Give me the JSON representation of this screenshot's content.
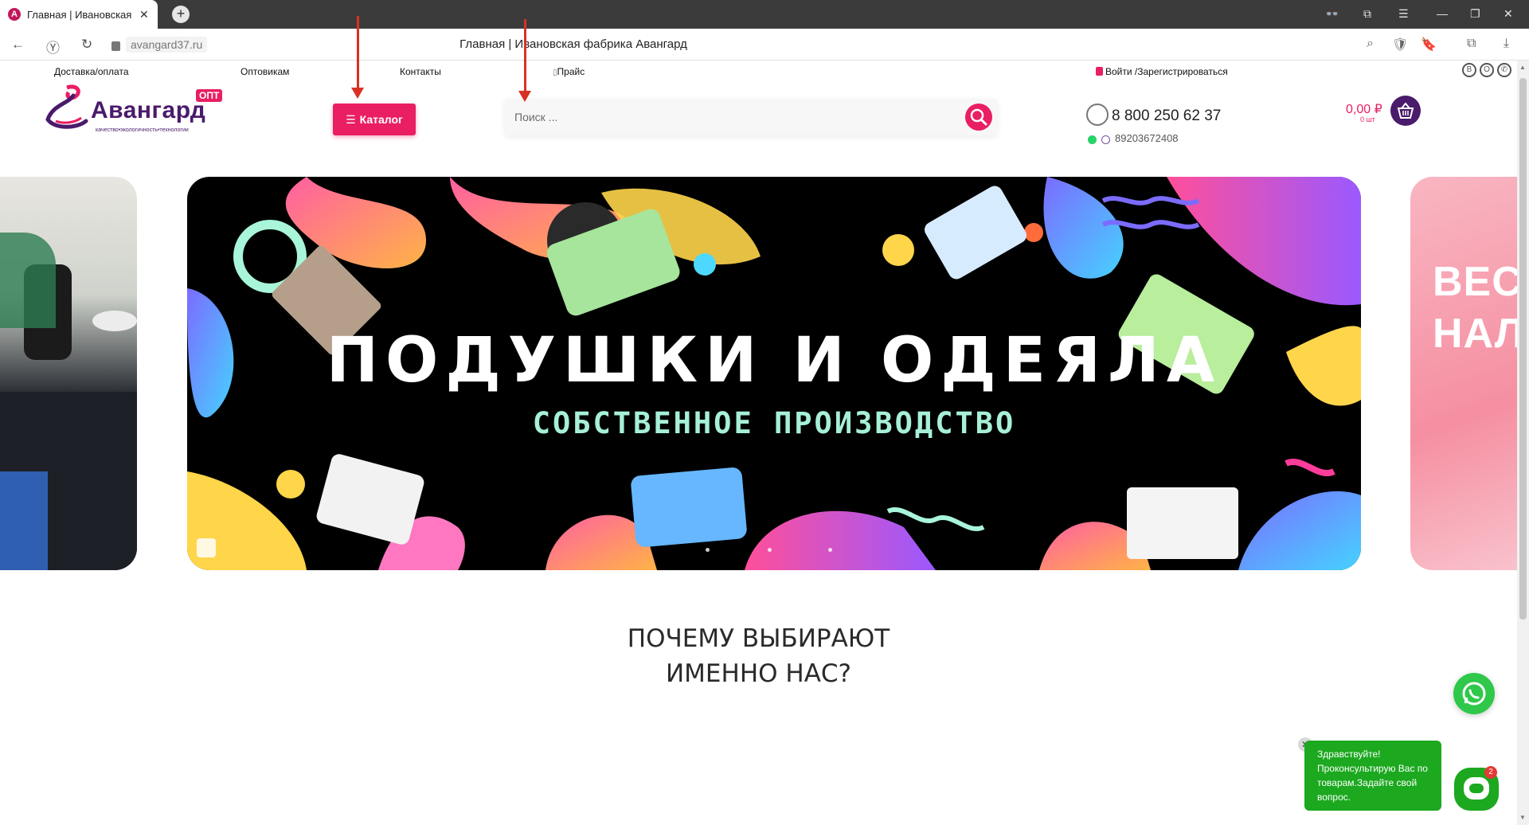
{
  "browser": {
    "tab_title": "Главная | Ивановская ф",
    "favicon_letter": "A",
    "url": "avangard37.ru",
    "page_title": "Главная | Ивановская фабрика Авангард"
  },
  "topnav": {
    "delivery": "Доставка/оплата",
    "wholesale": "Оптовикам",
    "contacts": "Контакты",
    "price": "Прайс",
    "login": "Войти /Зарегистрироваться"
  },
  "logo": {
    "name": "Авангард",
    "badge": "ОПТ",
    "tagline": "качество•экологичность•технологии"
  },
  "catalog_label": "Каталог",
  "search": {
    "placeholder": "Поиск ..."
  },
  "contacts": {
    "phone_main": "8 800 250 62 37",
    "phone_messenger": "89203672408"
  },
  "cart": {
    "total": "0,00 ₽",
    "count": "0 шт"
  },
  "slider": {
    "headline": "ПОДУШКИ И ОДЕЯЛА",
    "subheadline": "СОБСТВЕННОЕ ПРОИЗВОДСТВО",
    "next_slide_text": "ВЕС НАЛ"
  },
  "section": {
    "why_line1": "ПОЧЕМУ ВЫБИРАЮТ",
    "why_line2": "ИМЕННО НАС?"
  },
  "chat": {
    "greeting": "Здравствуйте! Проконсультирую Вас по товарам.Задайте свой вопрос.",
    "badge_count": "2"
  },
  "colors": {
    "accent": "#e91e63",
    "brand_purple": "#4a1a6b",
    "whatsapp_green": "#2fc84a",
    "chat_green": "#1ca81f"
  }
}
